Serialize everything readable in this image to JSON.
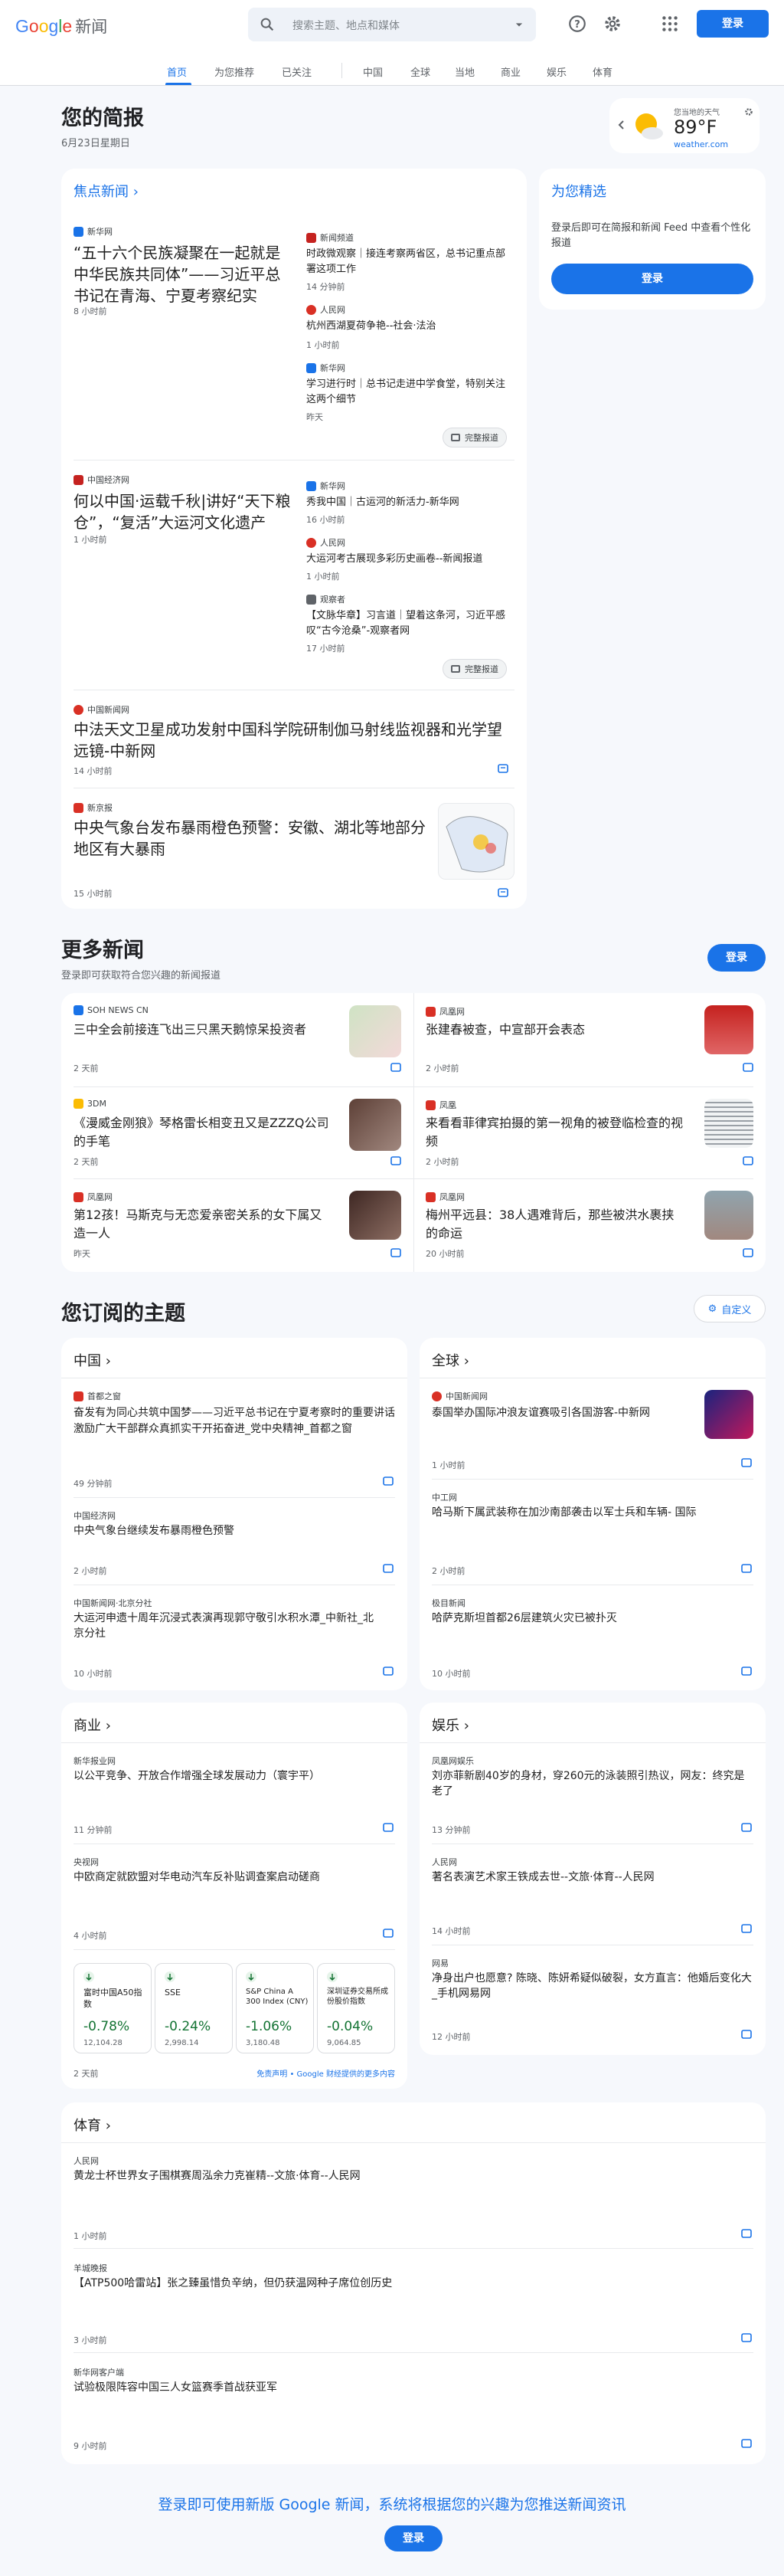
{
  "header": {
    "logo_google": "Google",
    "logo_news": "新闻",
    "search_placeholder": "搜索主题、地点和媒体",
    "login": "登录",
    "nav": [
      "首页",
      "为您推荐",
      "已关注",
      "中国",
      "全球",
      "当地",
      "商业",
      "娱乐",
      "体育"
    ],
    "active_nav": "首页",
    "brand_colors": {
      "blue": "#4285f4",
      "red": "#ea4335",
      "yellow": "#fbbc04",
      "green": "#34a853"
    }
  },
  "briefing": {
    "title": "您的简报",
    "date": "6月23日星期日",
    "weather": {
      "location": "您当地的天气",
      "temp": "89°F",
      "source": "weather.com",
      "icon": "sun-cloud-icon"
    }
  },
  "headlines": {
    "section_title": "焦点新闻",
    "full_coverage": "完整报道",
    "clusters": [
      {
        "main": {
          "source": "新华网",
          "title": "“五十六个民族凝聚在一起就是中华民族共同体”——习近平总书记在青海、宁夏考察纪实",
          "time": "8 小时前"
        },
        "side": [
          {
            "source": "新闻频道",
            "title": "时政微观察｜接连考察两省区，总书记重点部署这项工作",
            "time": "14 分钟前"
          },
          {
            "source": "人民网",
            "title": "杭州西湖夏荷争艳--社会·法治",
            "time": "1 小时前"
          },
          {
            "source": "新华网",
            "title": "学习进行时｜总书记走进中学食堂，特别关注这两个细节",
            "time": "昨天"
          }
        ]
      },
      {
        "main": {
          "source": "中国经济网",
          "title": "何以中国·运载千秋|讲好“天下粮仓”，“复活”大运河文化遗产",
          "time": "1 小时前"
        },
        "side": [
          {
            "source": "新华网",
            "title": "秀我中国｜古运河的新活力-新华网",
            "time": "16 小时前"
          },
          {
            "source": "人民网",
            "title": "大运河考古展现多彩历史画卷--新闻报道",
            "time": "1 小时前"
          },
          {
            "source": "观察者",
            "title": "【文脉华章】习言道｜望着这条河，习近平感叹“古今沧桑”-观察者网",
            "time": "17 小时前"
          }
        ]
      }
    ],
    "single": [
      {
        "source": "中国新闻网",
        "title": "中法天文卫星成功发射中国科学院研制伽马射线监视器和光学望远镜-中新网",
        "time": "14 小时前"
      },
      {
        "source": "新京报",
        "title": "中央气象台发布暴雨橙色预警：安徽、湖北等地部分地区有大暴雨",
        "time": "15 小时前"
      }
    ]
  },
  "picks": {
    "title": "为您精选",
    "desc": "登录后即可在简报和新闻 Feed 中查看个性化报道",
    "login": "登录"
  },
  "more_news": {
    "title": "更多新闻",
    "subtitle": "登录即可获取符合您兴趣的新闻报道",
    "login": "登录",
    "items": [
      {
        "source": "SOH NEWS CN",
        "title": "三中全会前接连飞出三只黑天鹅惊呆投资者",
        "time": "2 天前"
      },
      {
        "source": "凤凰网",
        "title": "张建春被查，中宣部开会表态",
        "time": "2 小时前"
      },
      {
        "source": "3DM",
        "title": "《漫威金刚狼》琴格雷长相变丑又是ZZZQ公司的手笔",
        "time": "2 天前"
      },
      {
        "source": "凤凰",
        "title": "来看看菲律宾拍摄的第一视角的被登临检查的视频",
        "time": "2 小时前"
      },
      {
        "source": "凤凰网",
        "title": "第12孩！马斯克与无恋爱亲密关系的女下属又造一人",
        "time": "昨天"
      },
      {
        "source": "凤凰网",
        "title": "梅州平远县：38人遇难背后，那些被洪水裹挟的命运",
        "time": "20 小时前"
      }
    ]
  },
  "topics": {
    "title": "您订阅的主题",
    "customize": "自定义",
    "china": {
      "title": "中国",
      "items": [
        {
          "source": "首都之窗",
          "title": "奋发有为同心共筑中国梦——习近平总书记在宁夏考察时的重要讲话激励广大干部群众真抓实干开拓奋进_党中央精神_首都之窗",
          "time": "49 分钟前"
        },
        {
          "source": "中国经济网",
          "title": "中央气象台继续发布暴雨橙色预警",
          "time": "2 小时前"
        },
        {
          "source": "中国新闻网·北京分社",
          "title": "大运河申遗十周年沉浸式表演再现郭守敬引水积水潭_中新社_北京分社",
          "time": "10 小时前"
        }
      ]
    },
    "world": {
      "title": "全球",
      "items": [
        {
          "source": "中国新闻网",
          "title": "泰国举办国际冲浪友谊赛吸引各国游客-中新网",
          "time": "1 小时前"
        },
        {
          "source": "中工网",
          "title": "哈马斯下属武装称在加沙南部袭击以军士兵和车辆- 国际",
          "time": "2 小时前"
        },
        {
          "source": "极目新闻",
          "title": "哈萨克斯坦首都26层建筑火灾已被扑灭",
          "time": "10 小时前"
        }
      ]
    },
    "business": {
      "title": "商业",
      "items": [
        {
          "source": "新华报业网",
          "title": "以公平竞争、开放合作增强全球发展动力（寰宇平）",
          "time": "11 分钟前"
        },
        {
          "source": "央视网",
          "title": "中欧商定就欧盟对华电动汽车反补贴调查案启动磋商",
          "time": "4 小时前"
        }
      ],
      "stocks": [
        {
          "name": "富时中国A50指数",
          "change": "-0.78%",
          "price": "12,104.28"
        },
        {
          "name": "SSE",
          "change": "-0.24%",
          "price": "2,998.14"
        },
        {
          "name": "S&P China A 300 Index (CNY)",
          "change": "-1.06%",
          "price": "3,180.48"
        },
        {
          "name": "深圳证券交易所成份股价指数",
          "change": "-0.04%",
          "price": "9,064.85"
        }
      ],
      "stock_time": "2 天前",
      "disclaimer": "免责声明 • Google 财经提供的更多内容"
    },
    "entertainment": {
      "title": "娱乐",
      "items": [
        {
          "source": "凤凰网娱乐",
          "title": "刘亦菲新剧40岁的身材，穿260元的泳装照引热议，网友：终究是老了",
          "time": "13 分钟前"
        },
        {
          "source": "人民网",
          "title": "著名表演艺术家王铁成去世--文旅·体育--人民网",
          "time": "14 小时前"
        },
        {
          "source": "网易",
          "title": "净身出户也愿意? 陈晓、陈妍希疑似破裂，女方直言：他婚后变化大_手机网易网",
          "time": "12 小时前"
        }
      ]
    },
    "sports": {
      "title": "体育",
      "items": [
        {
          "source": "人民网",
          "title": "黄龙士杯世界女子围棋赛周泓余力克崔精--文旅·体育--人民网",
          "time": "1 小时前"
        },
        {
          "source": "羊城晚报",
          "title": "【ATP500哈雷站】张之臻虽惜负辛纳，但仍获温网种子席位创历史",
          "time": "3 小时前"
        },
        {
          "source": "新华网客户端",
          "title": "试验极限阵容中国三人女篮赛季首战获亚军",
          "time": "9 小时前"
        }
      ]
    }
  },
  "footer": {
    "text": "登录即可使用新版 Google 新闻，系统将根据您的兴趣为您推送新闻资讯",
    "login": "登录"
  }
}
